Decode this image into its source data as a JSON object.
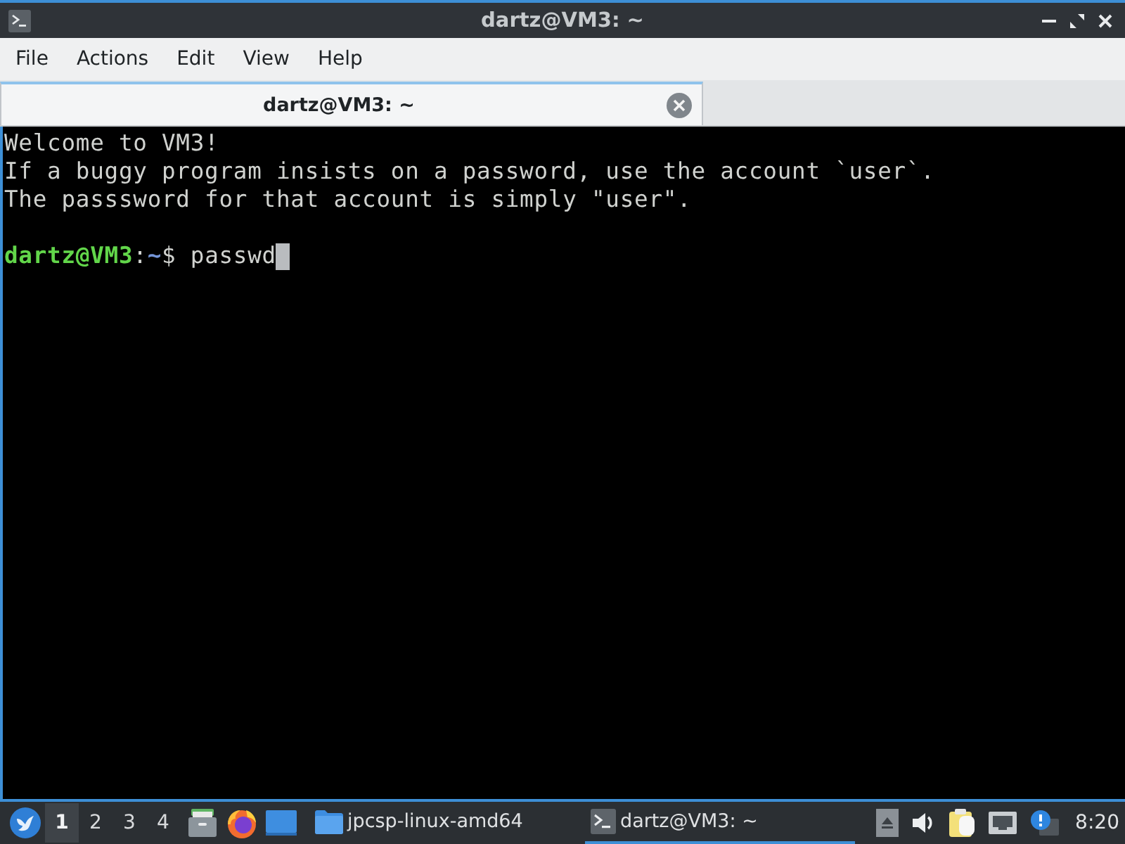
{
  "window": {
    "title": "dartz@VM3: ~"
  },
  "menu_bar": [
    "File",
    "Actions",
    "Edit",
    "View",
    "Help"
  ],
  "tabs": [
    {
      "label": "dartz@VM3: ~",
      "selected": true
    }
  ],
  "terminal": {
    "lines": [
      {
        "kind": "output",
        "text": "Welcome to VM3!"
      },
      {
        "kind": "output",
        "text": "If a buggy program insists on a password, use the account `user`."
      },
      {
        "kind": "output",
        "text": "The passsword for that account is simply \"user\"."
      },
      {
        "kind": "blank"
      },
      {
        "kind": "prompt",
        "user_host": "dartz@VM3",
        "separator": ":",
        "path": "~",
        "symbol": "$",
        "command": "passwd"
      }
    ]
  },
  "taskbar": {
    "workspaces": [
      {
        "label": "1",
        "selected": true
      },
      {
        "label": "2",
        "selected": false
      },
      {
        "label": "3",
        "selected": false
      },
      {
        "label": "4",
        "selected": false
      }
    ],
    "tasks": [
      {
        "kind": "folder",
        "label": "jpcsp-linux-amd64",
        "selected": false
      },
      {
        "kind": "terminal",
        "label": "dartz@VM3: ~",
        "selected": true
      }
    ],
    "clock": "8:20"
  }
}
